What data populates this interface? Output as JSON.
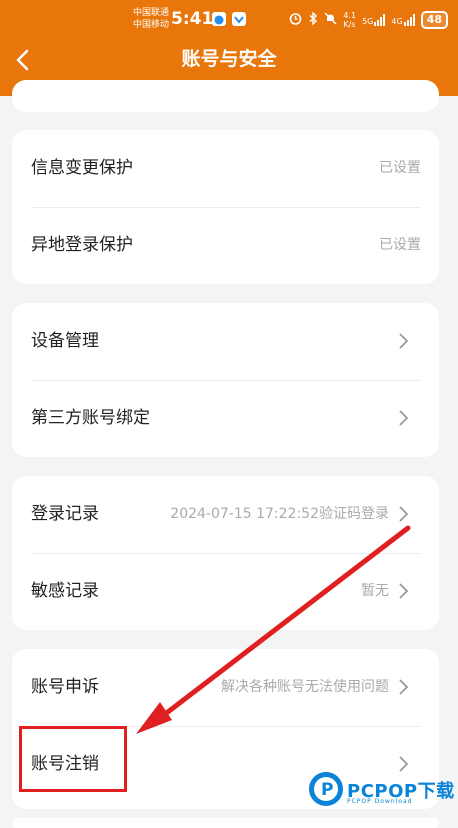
{
  "status_bar": {
    "carrier_1": "中国联通",
    "carrier_2": "中国移动",
    "time": "5:41",
    "net_speed_top": "4.1",
    "net_speed_unit": "K/s",
    "net_1": "5G",
    "net_2": "4G",
    "battery": "48"
  },
  "header": {
    "title": "账号与安全"
  },
  "sections": {
    "protection": {
      "info_change": {
        "label": "信息变更保护",
        "value": "已设置"
      },
      "remote_login": {
        "label": "异地登录保护",
        "value": "已设置"
      }
    },
    "devices": {
      "device_mgmt": {
        "label": "设备管理"
      },
      "third_party": {
        "label": "第三方账号绑定"
      }
    },
    "records": {
      "login_record": {
        "label": "登录记录",
        "value": "2024-07-15 17:22:52验证码登录"
      },
      "sensitive_record": {
        "label": "敏感记录",
        "value": "暂无"
      }
    },
    "account": {
      "appeal": {
        "label": "账号申诉",
        "value": "解决各种账号无法使用问题"
      },
      "cancel": {
        "label": "账号注销"
      }
    }
  },
  "watermark": {
    "logo_letter": "P",
    "text": "PCPOP下载",
    "sub": "PCPOP Download"
  },
  "colors": {
    "header_bg": "#e8760a",
    "highlight": "#e02020",
    "watermark": "#0a83d8"
  }
}
